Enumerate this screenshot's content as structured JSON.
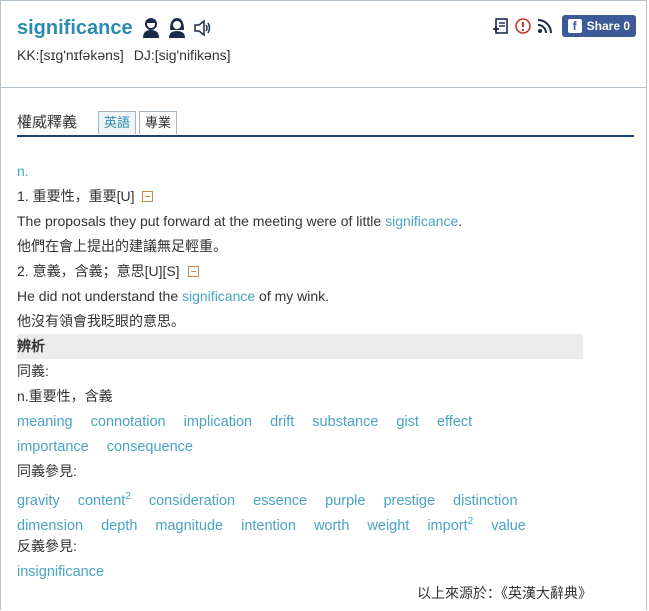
{
  "header": {
    "headword": "significance",
    "pronunciation": {
      "kk": "KK:[sɪg'nɪfəkəns]",
      "dj": "DJ:[sig'nifikəns]"
    },
    "share_label": "Share 0"
  },
  "tabs": {
    "title": "權威釋義",
    "english": "英語",
    "professional": "專業"
  },
  "entry": {
    "pos": "n.",
    "senses": [
      {
        "def": "1. 重要性，重要[U]",
        "example_before": "The proposals they put forward at the meeting were of little ",
        "example_keyword": "significance",
        "example_after": ".",
        "translation": "他們在會上提出的建議無足輕重。"
      },
      {
        "def": "2. 意義，含義；意思[U][S]",
        "example_before": "He did not understand the ",
        "example_keyword": "significance",
        "example_after": " of my wink.",
        "translation": "他沒有領會我眨眼的意思。"
      }
    ]
  },
  "analysis": {
    "heading": "辨析",
    "synonym_label": "同義:",
    "synonym_sense": "n.重要性，含義",
    "synonyms_row1": [
      "meaning",
      "connotation",
      "implication",
      "drift",
      "substance",
      "gist",
      "effect"
    ],
    "synonyms_row2": [
      "importance",
      "consequence"
    ],
    "see_also_label": "同義參見:",
    "see_also_row1": [
      "gravity",
      "content",
      "consideration",
      "essence",
      "purple",
      "prestige",
      "distinction"
    ],
    "see_also_row1_sup": "2",
    "see_also_row2": [
      "dimension",
      "depth",
      "magnitude",
      "intention",
      "worth",
      "weight",
      "import",
      "value"
    ],
    "see_also_row2_sup": "2",
    "antonym_label": "反義參見:",
    "antonyms": [
      "insignificance"
    ]
  },
  "footer": {
    "source": "以上來源於：《英漢大辭典》"
  },
  "icons": {
    "speaker_male": "person-speaker-icon",
    "speaker_female": "person-speaker-female-icon",
    "audio": "speaker-icon",
    "wordbook": "wordbook-add-icon",
    "report": "report-error-icon",
    "rss": "rss-icon",
    "facebook": "facebook-icon"
  },
  "colors": {
    "accent": "#2a8bb0",
    "link": "#4aa3c4",
    "tab_underline": "#1f3f7a",
    "facebook": "#3d5a98"
  }
}
